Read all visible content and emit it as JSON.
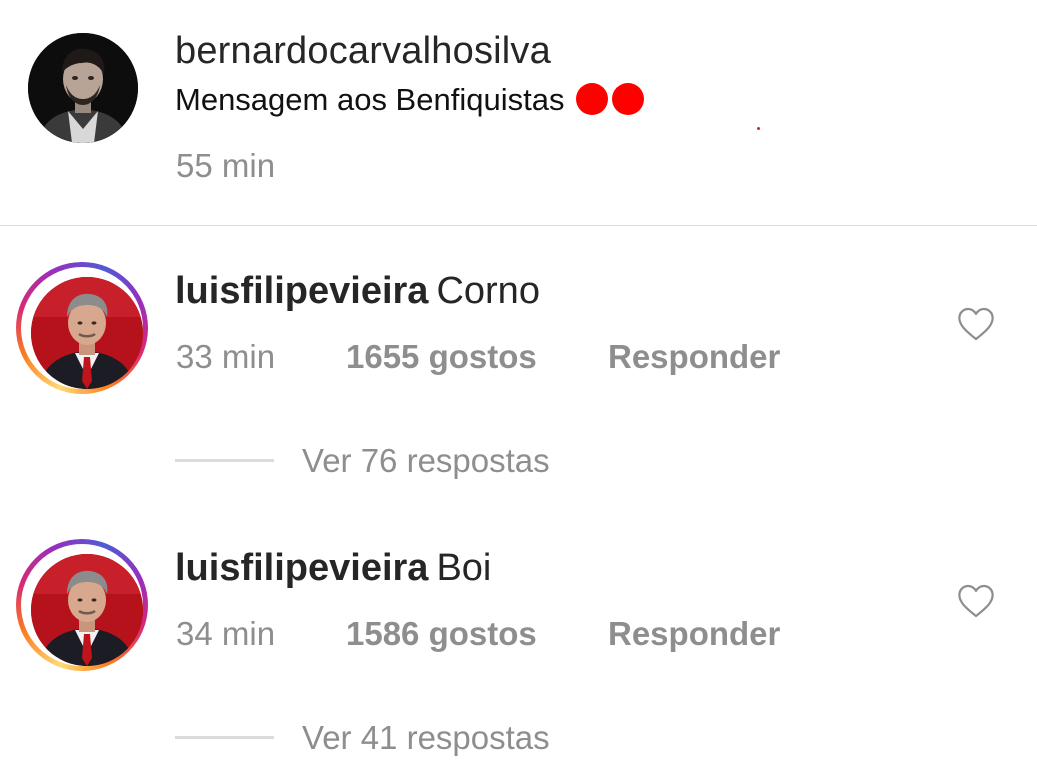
{
  "post": {
    "author": "bernardocarvalhosilva",
    "caption": "Mensagem aos Benfiquistas",
    "caption_emoji": [
      "red-circle",
      "red-circle"
    ],
    "time": "55 min"
  },
  "comments": [
    {
      "username": "luisfilipevieira",
      "text": "Corno",
      "time": "33 min",
      "likes": "1655 gostos",
      "reply_label": "Responder",
      "view_replies": "Ver 76 respostas"
    },
    {
      "username": "luisfilipevieira",
      "text": "Boi",
      "time": "34 min",
      "likes": "1586 gostos",
      "reply_label": "Responder",
      "view_replies": "Ver 41 respostas"
    }
  ],
  "colors": {
    "text_primary": "#262626",
    "text_secondary": "#8e8e8e",
    "divider": "#dbdbdb",
    "emoji_red": "#ff0000"
  },
  "icons": {
    "like": "heart-outline-icon",
    "avatar_post": "profile-photo",
    "avatar_comment": "profile-photo-story-ring"
  }
}
